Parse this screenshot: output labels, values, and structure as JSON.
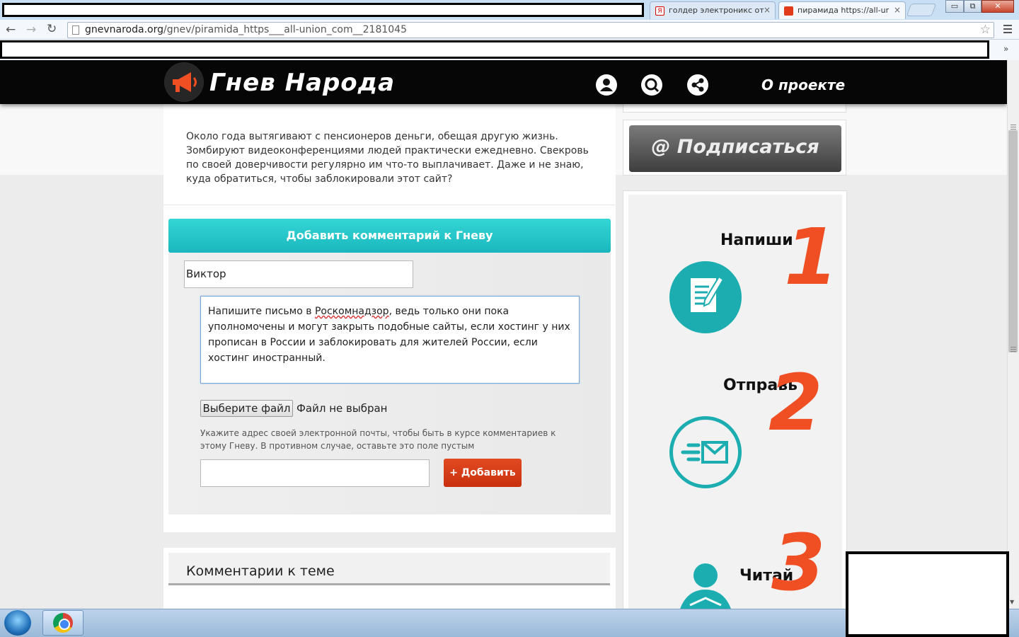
{
  "browser": {
    "tabs": [
      {
        "title": "голдер электроникс от",
        "favicon": "Я"
      },
      {
        "title": "пирамида https://all-ur",
        "favicon": "megaphone-icon",
        "active": true
      }
    ],
    "close_glyph": "×",
    "window_buttons": {
      "minimize": "▭",
      "maximize": "⧉",
      "close": "✕"
    },
    "nav": {
      "back": "←",
      "forward": "→",
      "reload": "↻"
    },
    "url_host": "gnevnaroda.org",
    "url_path": "/gnev/piramida_https___all-union_com__2181045",
    "bookmark_star": "☆",
    "bookmarks_overflow": "»"
  },
  "site": {
    "logo": "Гнев Народа",
    "nav_about": "О проекте",
    "header_icons": [
      "user-icon",
      "search-icon",
      "share-icon"
    ],
    "accent": "#f04e23",
    "teal": "#1cbcc0"
  },
  "post": {
    "text": "Около года вытягивают с пенсионеров деньги, обещая другую жизнь. Зомбируют видеоконференциями людей практически ежедневно. Свекровь по своей доверчивости регулярно им что-то выплачивает. Даже и не знаю, куда обратиться, чтобы заблокировали этот сайт?"
  },
  "comment_form": {
    "header": "Добавить комментарий к Гневу",
    "name_value": "Виктор",
    "message_before": "Напишите письмо в ",
    "message_link": "Роскомнадзор",
    "message_after": ", ведь только они пока уполномочены и могут закрыть подобные сайты, если хостинг у них прописан в России и заблокировать для жителей России, если хостинг иностранный.",
    "file_button": "Выберите файл",
    "file_status": "Файл не выбран",
    "email_hint": "Укажите адрес своей электронной почты, чтобы быть в курсе комментариев к этому Гневу. В противном случае, оставьте это поле пустым",
    "email_value": "",
    "submit": "+ Добавить"
  },
  "comments": {
    "title": "Комментарии к теме"
  },
  "sidebar": {
    "subscribe": "@ Подписаться",
    "steps": [
      {
        "word": "Напиши",
        "num": "1",
        "icon": "document-pen-icon"
      },
      {
        "word": "Отправь",
        "num": "2",
        "icon": "envelope-send-icon"
      },
      {
        "word": "Читай",
        "num": "3",
        "icon": "reader-icon"
      }
    ]
  }
}
